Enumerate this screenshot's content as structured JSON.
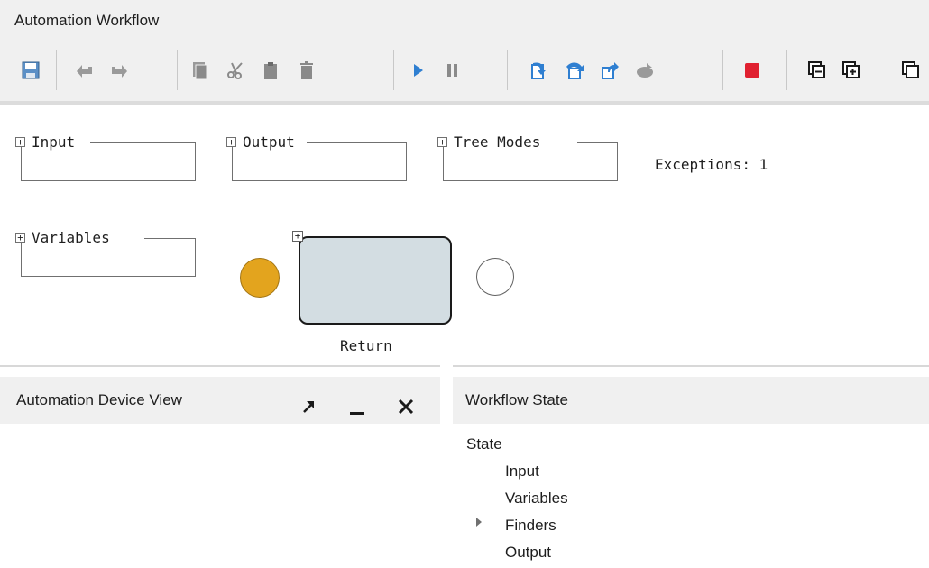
{
  "app": {
    "title": "Automation Workflow"
  },
  "toolbar": {
    "buttons": [
      {
        "name": "save-button",
        "icon": "save-icon"
      },
      {
        "name": "undo-button",
        "icon": "undo-icon"
      },
      {
        "name": "redo-button",
        "icon": "redo-icon"
      },
      {
        "name": "copy-button",
        "icon": "copy-icon"
      },
      {
        "name": "cut-button",
        "icon": "scissors-icon"
      },
      {
        "name": "paste-button",
        "icon": "paste-icon"
      },
      {
        "name": "delete-button",
        "icon": "trash-icon"
      },
      {
        "name": "run-button",
        "icon": "play-icon"
      },
      {
        "name": "pause-button",
        "icon": "pause-icon"
      },
      {
        "name": "step-into-button",
        "icon": "step-into-icon"
      },
      {
        "name": "step-over-button",
        "icon": "step-over-icon"
      },
      {
        "name": "step-out-button",
        "icon": "step-out-icon"
      },
      {
        "name": "breakpoint-button",
        "icon": "breakpoint-icon"
      },
      {
        "name": "stop-button",
        "icon": "stop-icon"
      },
      {
        "name": "collapse-all-button",
        "icon": "collapse-icon"
      },
      {
        "name": "expand-all-button",
        "icon": "expand-icon"
      },
      {
        "name": "window-button",
        "icon": "window-icon"
      }
    ]
  },
  "canvas": {
    "groups": {
      "input": "Input",
      "output": "Output",
      "tree_modes": "Tree Modes",
      "variables": "Variables"
    },
    "exceptions": "Exceptions: 1",
    "activity_label": "Return",
    "expander_glyph": "+"
  },
  "device_view": {
    "title": "Automation Device View"
  },
  "workflow_state": {
    "title": "Workflow State",
    "tree": {
      "root": "State",
      "children": [
        "Input",
        "Variables",
        "Finders",
        "Output"
      ]
    }
  },
  "colors": {
    "start_node": "#e3a41e",
    "activity_fill": "#d3dde2",
    "run_blue": "#2f7fd1",
    "stop_red": "#e02030",
    "disabled_gray": "#9a9a9a"
  }
}
